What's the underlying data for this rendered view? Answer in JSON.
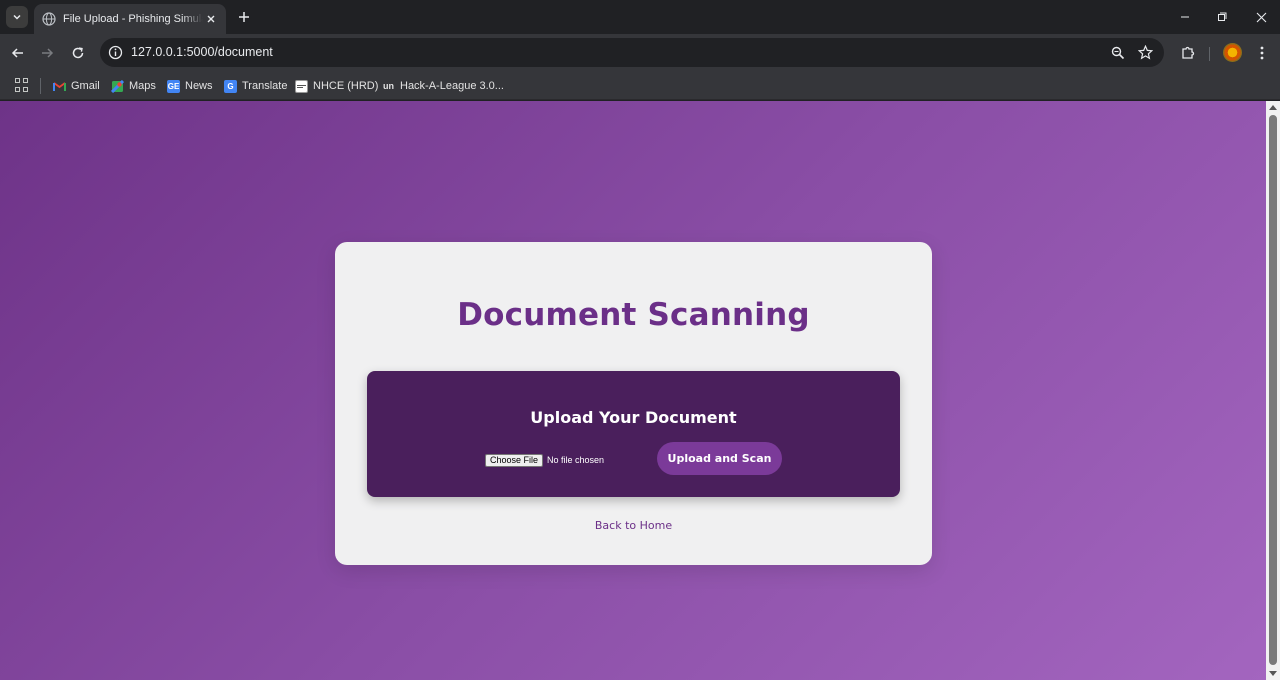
{
  "browser": {
    "tab": {
      "title": "File Upload - Phishing Simulation",
      "favicon": "globe-icon"
    },
    "url": "127.0.0.1:5000/document",
    "bookmarks": [
      {
        "label": "Gmail",
        "icon": "gmail-icon"
      },
      {
        "label": "Maps",
        "icon": "maps-icon"
      },
      {
        "label": "News",
        "icon": "news-icon"
      },
      {
        "label": "Translate",
        "icon": "translate-icon"
      },
      {
        "label": "NHCE (HRD)",
        "icon": "nhce-icon"
      },
      {
        "label": "Hack-A-League 3.0...",
        "icon": "unstop-icon"
      }
    ],
    "bookmark_icon_text": {
      "news": "GE",
      "translate": "G",
      "unstop": "un"
    }
  },
  "page": {
    "title": "Document Scanning",
    "upload": {
      "heading": "Upload Your Document",
      "choose_label": "Choose File",
      "file_status": "No file chosen",
      "submit_label": "Upload and Scan"
    },
    "back_link": "Back to Home"
  },
  "colors": {
    "primary": "#6b2f88",
    "upload_box": "#4a1f5c",
    "button": "#7b3a99",
    "card": "#f0f0f1"
  }
}
